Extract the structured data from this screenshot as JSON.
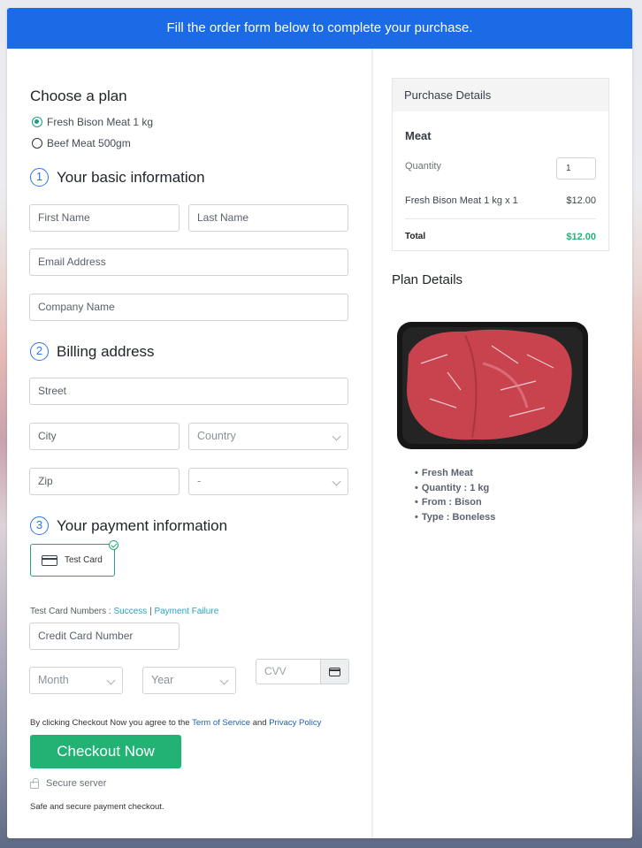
{
  "banner": {
    "text": "Fill the order form below to complete your purchase."
  },
  "plan": {
    "title": "Choose a plan",
    "options": [
      {
        "label": "Fresh Bison Meat 1 kg",
        "selected": true
      },
      {
        "label": "Beef Meat 500gm",
        "selected": false
      }
    ]
  },
  "basic_info": {
    "step": "1",
    "title": "Your basic information",
    "first_name": {
      "placeholder": "First Name",
      "value": ""
    },
    "last_name": {
      "placeholder": "Last Name",
      "value": ""
    },
    "email": {
      "placeholder": "Email Address",
      "value": ""
    },
    "company": {
      "placeholder": "Company Name",
      "value": ""
    }
  },
  "billing": {
    "step": "2",
    "title": "Billing address",
    "street": {
      "placeholder": "Street",
      "value": ""
    },
    "city": {
      "placeholder": "City",
      "value": ""
    },
    "country": {
      "selected": "Country"
    },
    "zip": {
      "placeholder": "Zip",
      "value": ""
    },
    "state": {
      "selected": "-"
    }
  },
  "payment": {
    "step": "3",
    "title": "Your payment information",
    "method": {
      "label": "Test Card",
      "icon": "credit-card-icon",
      "selected": true
    },
    "test_numbers_label": "Test Card Numbers : ",
    "success_link": "Success",
    "separator": "|",
    "failure_link": "Payment Failure",
    "card_number": {
      "placeholder": "Credit Card Number",
      "value": ""
    },
    "month": {
      "selected": "Month"
    },
    "year": {
      "selected": "Year"
    },
    "cvv": {
      "placeholder": "CVV",
      "value": ""
    }
  },
  "agreement": {
    "prefix": "By clicking Checkout Now you agree to the ",
    "terms": "Term of Service",
    "and": " and ",
    "privacy": "Privacy Policy"
  },
  "checkout": {
    "button": "Checkout Now",
    "secure": "Secure server",
    "note": "Safe and secure payment checkout."
  },
  "purchase": {
    "title": "Purchase Details",
    "product": "Meat",
    "quantity_label": "Quantity",
    "quantity_value": "1",
    "line_item": "Fresh Bison Meat 1 kg x 1",
    "line_price": "$12.00",
    "total_label": "Total",
    "total_value": "$12.00",
    "total_color": "#22b374"
  },
  "plan_details": {
    "title": "Plan Details",
    "image_alt": "Raw bison meat in black tray",
    "features": [
      "Fresh Meat",
      "Quantity : 1 kg",
      "From : Bison",
      "Type : Boneless"
    ]
  },
  "colors": {
    "brand_blue": "#1b6ae6",
    "accent_green": "#22b374",
    "link_teal": "#27a3c3"
  }
}
